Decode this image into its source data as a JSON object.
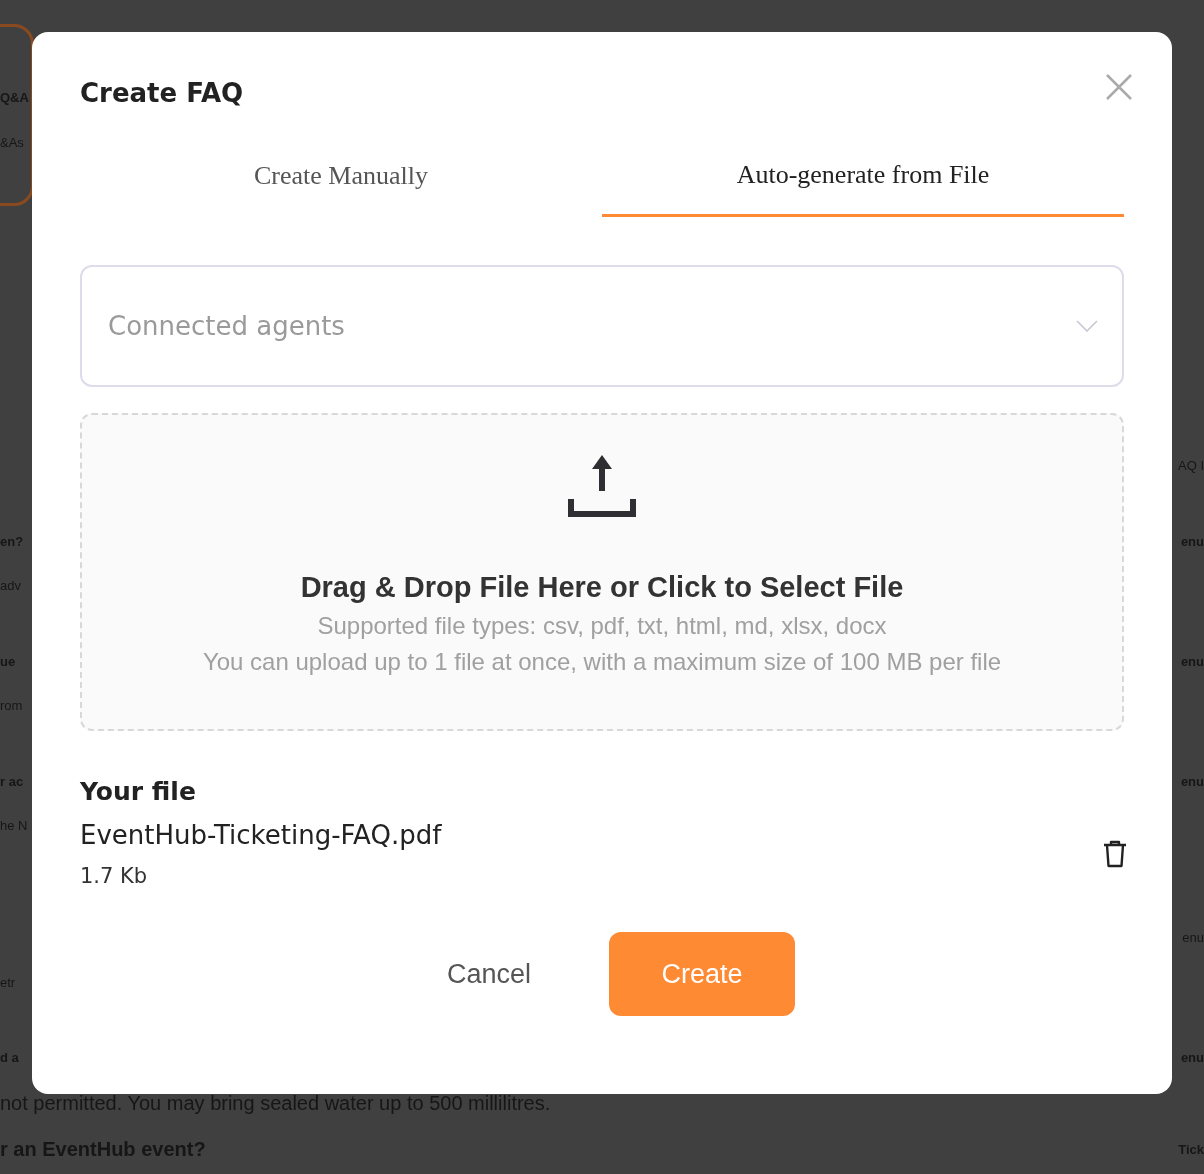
{
  "background": {
    "rows": [
      {
        "left": "Q&A",
        "kind": "heading"
      },
      {
        "left": "&As",
        "kind": "text"
      },
      {
        "right": "AQ I",
        "kind": "text"
      },
      {
        "left": "en?",
        "right": "enu",
        "kind": "heading"
      },
      {
        "left": "adv",
        "kind": "text"
      },
      {
        "left": "ue",
        "right": "enu",
        "kind": "heading"
      },
      {
        "left": "rom",
        "kind": "text"
      },
      {
        "left": "r ac",
        "right": "enu",
        "kind": "heading"
      },
      {
        "left": "he N",
        "kind": "text"
      },
      {
        "right": "enu",
        "kind": "text"
      },
      {
        "left": "etr",
        "kind": "text"
      },
      {
        "left": "d a",
        "right": "enu",
        "kind": "heading"
      },
      {
        "left": "not permitted. You may bring sealed water up to 500 millilitres.",
        "kind": "text"
      },
      {
        "left": "r an EventHub event?",
        "right": "Tick",
        "kind": "heading"
      }
    ]
  },
  "dialog": {
    "title": "Create FAQ",
    "tabs": [
      {
        "label": "Create Manually",
        "selected": false
      },
      {
        "label": "Auto-generate from File",
        "selected": true
      }
    ],
    "agents_select": {
      "placeholder": "Connected agents"
    },
    "dropzone": {
      "title": "Drag & Drop File Here or Click to Select File",
      "lines": [
        "Supported file types: csv, pdf, txt, html, md, xlsx, docx",
        "You can upload up to 1 file at once, with a maximum size of 100 MB per file"
      ]
    },
    "file_section": {
      "heading": "Your file",
      "file": {
        "name": "EventHub-Ticketing-FAQ.pdf",
        "size": "1.7 Kb"
      }
    },
    "buttons": [
      {
        "label": "Cancel",
        "kind": "secondary"
      },
      {
        "label": "Create",
        "kind": "primary"
      }
    ]
  }
}
